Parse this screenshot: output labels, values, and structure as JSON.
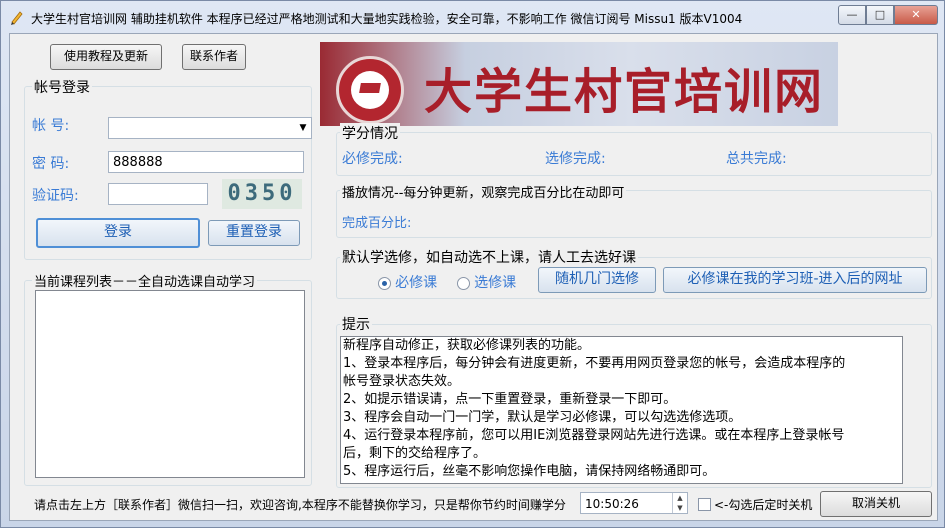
{
  "window": {
    "title": "大学生村官培训网 辅助挂机软件  本程序已经过严格地测试和大量地实践检验，安全可靠，不影响工作 微信订阅号 Missu1  版本V1004",
    "minimize": "—",
    "maximize": "□",
    "close": "✕"
  },
  "top_buttons": {
    "tutorial": "使用教程及更新",
    "contact": "联系作者"
  },
  "banner": {
    "text": "大学生村官培训网",
    "accent": "#a81e29"
  },
  "login": {
    "group_title": "帐号登录",
    "account_label": "帐    号:",
    "account_value": "",
    "password_label": "密    码:",
    "password_value": "888888",
    "captcha_label": "验证码:",
    "captcha_value": "",
    "captcha_image_text": "0350",
    "login_button": "登录",
    "relogin_button": "重置登录"
  },
  "courses": {
    "title": "当前课程列表－－全自动选课自动学习"
  },
  "credits": {
    "title": "学分情况",
    "required_label": "必修完成:",
    "elective_label": "选修完成:",
    "total_label": "总共完成:"
  },
  "playback": {
    "title": "播放情况--每分钟更新，观察完成百分比在动即可",
    "percent_label": "完成百分比:"
  },
  "course_select": {
    "title": "默认学选修，如自动选不上课，请人工去选好课",
    "required_option": "必修课",
    "elective_option": "选修课",
    "selected": "required",
    "random_button": "随机几门选修",
    "required_url_button": "必修课在我的学习班-进入后的网址"
  },
  "tips": {
    "title": "提示",
    "lines": [
      "新程序自动修正，获取必修课列表的功能。",
      " 1、登录本程序后，每分钟会有进度更新，不要再用网页登录您的帐号，会造成本程序的",
      "帐号登录状态失效。",
      "2、如提示错误请，点一下重置登录，重新登录一下即可。",
      "3、程序会自动一门一门学，默认是学习必修课，可以勾选选修选项。",
      "4、运行登录本程序前，您可以用IE浏览器登录网站先进行选课。或在本程序上登录帐号",
      "后，剩下的交给程序了。",
      "5、程序运行后，丝毫不影响您操作电脑，请保持网络畅通即可。"
    ]
  },
  "footer": {
    "message": "请点击左上方［联系作者］微信扫一扫，欢迎咨询,本程序不能替换你学习，只是帮你节约时间赚学分",
    "time_value": "10:50:26",
    "shutdown_label": "<-勾选后定时关机",
    "shutdown_checked": false,
    "cancel_shutdown": "取消关机"
  }
}
